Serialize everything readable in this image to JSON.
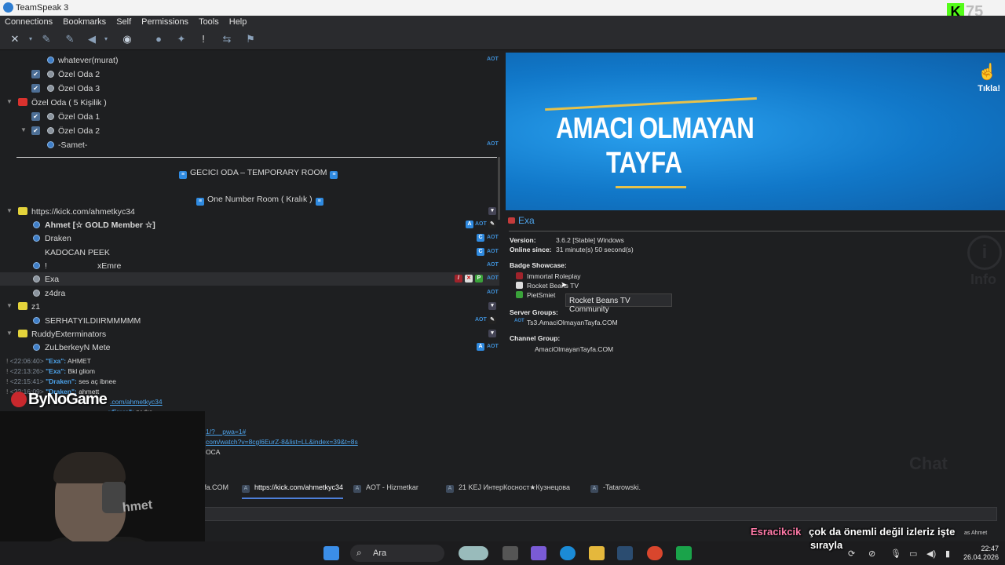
{
  "window": {
    "title": "TeamSpeak 3",
    "kick_number": "75"
  },
  "menu": [
    "Connections",
    "Bookmarks",
    "Self",
    "Permissions",
    "Tools",
    "Help"
  ],
  "tree": {
    "rows": [
      {
        "label": "whatever(murat)",
        "aot": "AOT"
      },
      {
        "label": "Özel Oda 2"
      },
      {
        "label": "Özel Oda 3"
      },
      {
        "label": "Özel Oda ( 5 Kişilik )"
      },
      {
        "label": "Özel Oda 1"
      },
      {
        "label": "Özel Oda 2"
      },
      {
        "label": "-Samet-",
        "aot": "AOT"
      },
      {
        "label": "GECICI ODA – TEMPORARY ROOM"
      },
      {
        "label": "One Number Room ( Kralık )"
      },
      {
        "label": "https://kick.com/ahmetkyc34"
      },
      {
        "label": "Ahmet [☆ GOLD Member ☆]",
        "aot": "AOT"
      },
      {
        "label": "Draken",
        "aot": "AOT"
      },
      {
        "label": "KADOCAN PEEK",
        "aot": "AOT"
      },
      {
        "label": "!",
        "label2": "xEmre",
        "aot": "AOT"
      },
      {
        "label": "Exa",
        "aot": "AOT"
      },
      {
        "label": "z4dra",
        "aot": "AOT"
      },
      {
        "label": "z1"
      },
      {
        "label": "SERHATYILDIIRMMMMM",
        "aot": "AOT"
      },
      {
        "label": "RuddyExterminators"
      },
      {
        "label": "ZuLberkeyN Mete",
        "aot": "AOT"
      }
    ]
  },
  "banner": {
    "line1": "AMACI OLMAYAN",
    "line2": "TAYFA",
    "tikla": "Tıkla!"
  },
  "info": {
    "nickname": "Exa",
    "version_label": "Version:",
    "version_value": "3.6.2 [Stable] Windows",
    "online_label": "Online since:",
    "online_value": "31 minute(s) 50 second(s)",
    "badge_label": "Badge Showcase:",
    "badges": [
      "Immortal Roleplay",
      "Rocket Beans TV",
      "PietSmiet"
    ],
    "server_groups_label": "Server Groups:",
    "server_group": "Ts3.AmaciOlmayanTayfa.COM",
    "channel_group_label": "Channel Group:",
    "channel_group": "AmaciOlmayanTayfa.COM",
    "tooltip": "Rocket Beans TV Community",
    "watermark_info": "i",
    "watermark_info_text": "Info"
  },
  "chat": {
    "lines": [
      {
        "ts": "<22:06:40>",
        "name": "\"Exa\":",
        "msg": " AHMET"
      },
      {
        "ts": "<22:13:26>",
        "name": "\"Exa\":",
        "msg": " Bkl gliom"
      },
      {
        "ts": "<22:15:41>",
        "name": "\"Draken\":",
        "msg": " ses aç ibnee"
      },
      {
        "ts": "<22:16:09>",
        "name": "\"Draken\":",
        "msg": " ahmett"
      },
      {
        "ts": "",
        "name": "",
        "msg": ".com/ahmetkyc34"
      },
      {
        "ts": "",
        "name": "xEmre\":",
        "msg": " zedra"
      }
    ],
    "links": [
      "1/?__pwa=1#",
      "com/watch?v=8cgl6EurZ-8&list=LL&index=39&t=8s",
      "OCA"
    ],
    "watermark": "Chat"
  },
  "tabs": [
    {
      "label": "fa.COM"
    },
    {
      "label": "https://kick.com/ahmetkyc34",
      "active": true
    },
    {
      "label": "AOT - Hizmetkar"
    },
    {
      "label": "21 KEJ ИнтерКосност★Кузнецова"
    },
    {
      "label": "-Tatarowski."
    }
  ],
  "overlay": {
    "user": "Esracikcik",
    "msg": "çok da önemli değil izleriz işte",
    "msg2": "sırayla",
    "small": "as Ahmet",
    "bynogame": "ByNoGame",
    "webcam_text": "hmet"
  },
  "taskbar": {
    "search_label": "Ara",
    "time": "22:47",
    "date": "26.04.2026"
  }
}
